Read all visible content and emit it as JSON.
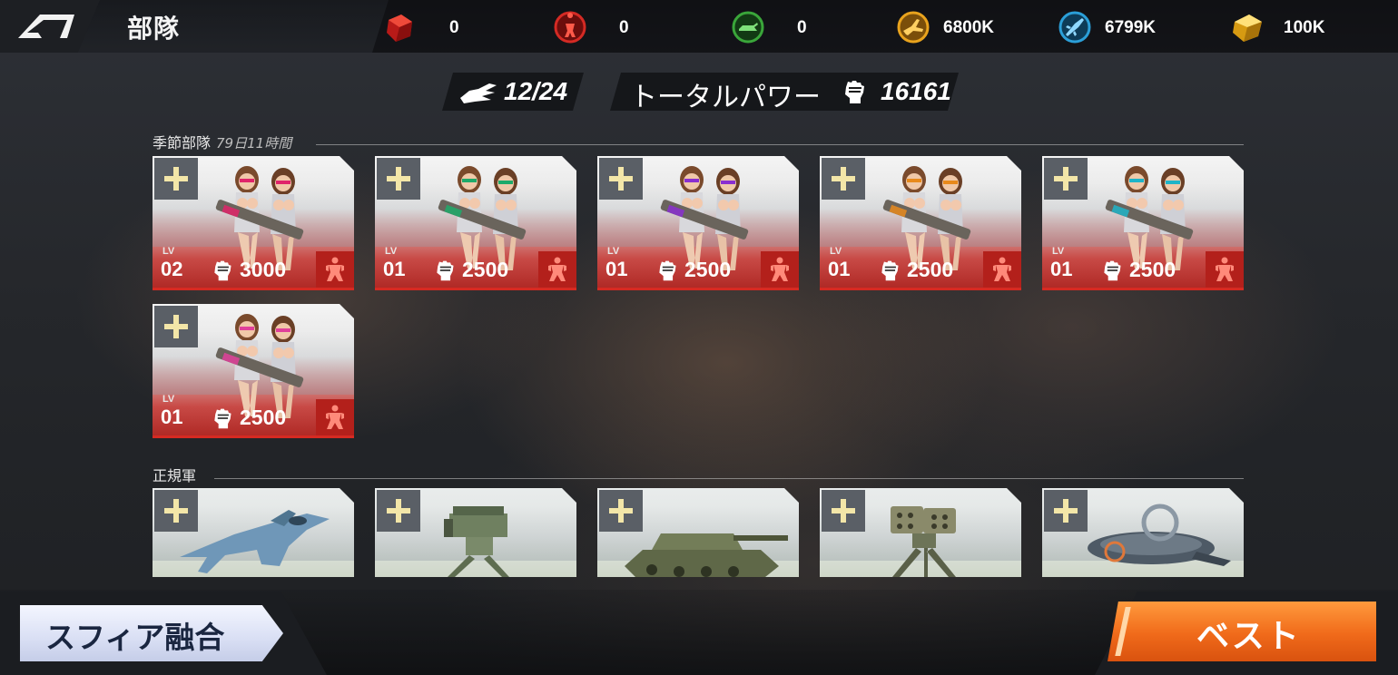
{
  "header": {
    "title": "部隊",
    "resources": [
      {
        "icon": "red-crystal-icon",
        "value": "0",
        "color": "#c8201e"
      },
      {
        "icon": "red-soldier-medal-icon",
        "value": "0",
        "color": "#d42a24"
      },
      {
        "icon": "green-tank-medal-icon",
        "value": "0",
        "color": "#3aa63a"
      },
      {
        "icon": "gold-aircraft-medal-icon",
        "value": "6800K",
        "color": "#e9a31d"
      },
      {
        "icon": "blue-jet-medal-icon",
        "value": "6799K",
        "color": "#2b9fd8"
      },
      {
        "icon": "gold-crystal-icon",
        "value": "100K",
        "color": "#e8b22a"
      }
    ]
  },
  "stats": {
    "unit_count": "12/24",
    "total_power_label": "トータルパワー",
    "total_power": "16161"
  },
  "seasonal": {
    "title": "季節部隊",
    "timer": "79日11時間",
    "cards": [
      {
        "lv_label": "LV",
        "level": "02",
        "power": "3000",
        "accent": "#e0246a"
      },
      {
        "lv_label": "LV",
        "level": "01",
        "power": "2500",
        "accent": "#1faa6a"
      },
      {
        "lv_label": "LV",
        "level": "01",
        "power": "2500",
        "accent": "#8a2fd0"
      },
      {
        "lv_label": "LV",
        "level": "01",
        "power": "2500",
        "accent": "#e88a1c"
      },
      {
        "lv_label": "LV",
        "level": "01",
        "power": "2500",
        "accent": "#1fb4c8"
      },
      {
        "lv_label": "LV",
        "level": "01",
        "power": "2500",
        "accent": "#e0409a"
      }
    ]
  },
  "regular": {
    "title": "正規軍",
    "cards": [
      {
        "icon": "jet-fighter-icon"
      },
      {
        "icon": "missile-mech-icon"
      },
      {
        "icon": "tank-icon"
      },
      {
        "icon": "rocket-walker-icon"
      },
      {
        "icon": "hover-ship-icon"
      }
    ]
  },
  "footer": {
    "sphere_fusion_label": "スフィア融合",
    "best_label": "ベスト"
  }
}
